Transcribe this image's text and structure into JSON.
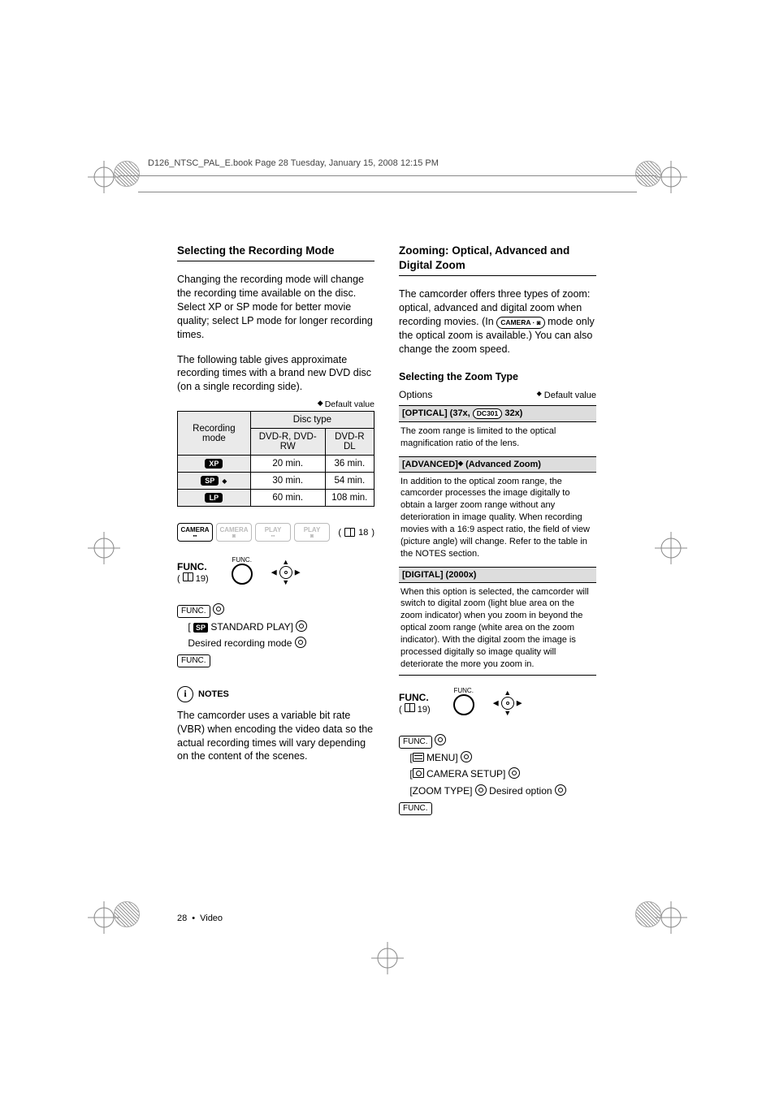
{
  "header": {
    "line": "D126_NTSC_PAL_E.book  Page 28  Tuesday, January 15, 2008  12:15 PM"
  },
  "left": {
    "h": "Selecting the Recording Mode",
    "p1": "Changing the recording mode will change the recording time available on the disc. Select XP or SP mode for better movie quality; select LP mode for longer recording times.",
    "p2": "The following table gives approximate recording times with a brand new DVD disc (on a single recording side).",
    "default": "Default value",
    "table": {
      "rm": "Recording mode",
      "dt": "Disc type",
      "c1": "DVD-R, DVD-RW",
      "c2": "DVD-R DL",
      "rows": [
        {
          "mode": "XP",
          "dvdr": "20 min.",
          "dl": "36 min."
        },
        {
          "mode": "SP",
          "default": true,
          "dvdr": "30 min.",
          "dl": "54 min."
        },
        {
          "mode": "LP",
          "dvdr": "60 min.",
          "dl": "108 min."
        }
      ]
    },
    "badges": {
      "b1": "CAMERA",
      "b2": "CAMERA",
      "b3": "PLAY",
      "b4": "PLAY",
      "pgref": "18"
    },
    "func": {
      "label": "FUNC.",
      "ref": "19",
      "tiny": "FUNC."
    },
    "seq": {
      "func": "FUNC.",
      "sp": "SP",
      "std": "STANDARD PLAY]",
      "desired": "Desired recording mode",
      "func2": "FUNC."
    },
    "notes": {
      "head": "NOTES",
      "body": "The camcorder uses a variable bit rate (VBR) when encoding the video data so the actual recording times will vary depending on the content of the scenes."
    }
  },
  "right": {
    "h": "Zooming: Optical, Advanced and Digital Zoom",
    "p1a": "The camcorder offers three types of zoom: optical, advanced and digital zoom when recording movies. (In",
    "pill": "CAMERA ·",
    "p1b": "mode only the optical zoom is available.) You can also change the zoom speed.",
    "sub": "Selecting the Zoom Type",
    "optionsLabel": "Options",
    "default": "Default value",
    "opt1": {
      "title_a": "[OPTICAL] (37x,",
      "model": "DC301",
      "title_b": "32x)",
      "body": "The zoom range is limited to the optical magnification ratio of the lens."
    },
    "opt2": {
      "title": "[ADVANCED]",
      "default": true,
      "suffix": "(Advanced Zoom)",
      "body": "In addition to the optical zoom range, the camcorder processes the image digitally to obtain a larger zoom range without any deterioration in image quality. When recording movies with a 16:9 aspect ratio, the field of view (picture angle) will change. Refer to the table in the NOTES section."
    },
    "opt3": {
      "title": "[DIGITAL] (2000x)",
      "body": "When this option is selected, the camcorder will switch to digital zoom (light blue area on the zoom indicator) when you zoom in beyond the optical zoom range (white area on the zoom indicator). With the digital zoom the image is processed digitally so image quality will deteriorate the more you zoom in."
    },
    "func": {
      "label": "FUNC.",
      "ref": "19",
      "tiny": "FUNC."
    },
    "seq": {
      "func": "FUNC.",
      "menu": "MENU]",
      "cam": "CAMERA SETUP]",
      "zt": "[ZOOM TYPE]",
      "desired": "Desired option",
      "func2": "FUNC."
    }
  },
  "footer": {
    "page": "28",
    "section": "Video"
  }
}
